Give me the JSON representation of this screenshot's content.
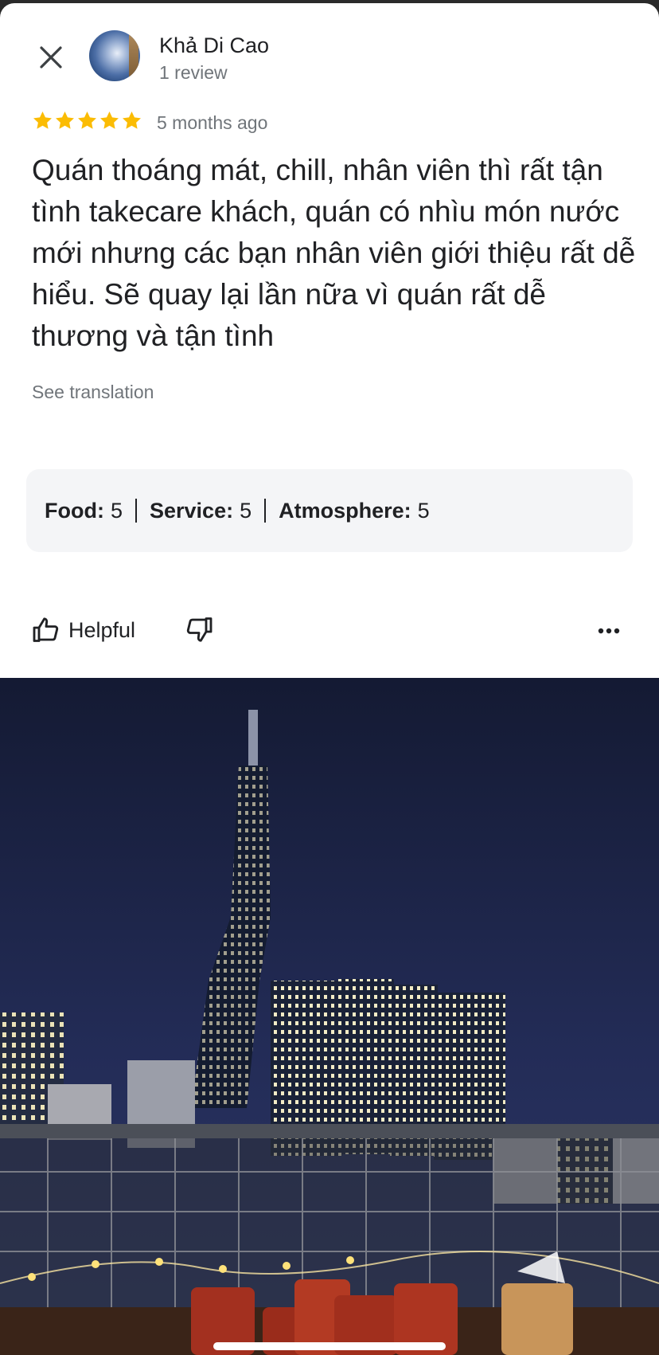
{
  "review": {
    "author_name": "Khả Di Cao",
    "author_subtitle": "1 review",
    "rating": 5,
    "time_ago": "5 months ago",
    "text": "Quán thoáng mát, chill, nhân viên thì rất tận tình takecare khách, quán có nhìu món nước mới nhưng các bạn nhân viên giới thiệu rất dễ hiểu. Sẽ quay lại lần nữa vì quán rất dễ thương và tận tình",
    "see_translation": "See translation"
  },
  "ratings": [
    {
      "label": "Food:",
      "value": "5"
    },
    {
      "label": "Service:",
      "value": "5"
    },
    {
      "label": "Atmosphere:",
      "value": "5"
    }
  ],
  "actions": {
    "helpful_label": "Helpful"
  },
  "icons": {
    "close": "close-icon",
    "star": "star-icon",
    "thumbs_up": "thumbs-up-icon",
    "thumbs_down": "thumbs-down-icon",
    "more": "more-horizontal-icon"
  },
  "colors": {
    "star": "#fbbc04",
    "text_primary": "#202124",
    "text_secondary": "#70757a",
    "ratings_bg": "#f4f5f7"
  }
}
